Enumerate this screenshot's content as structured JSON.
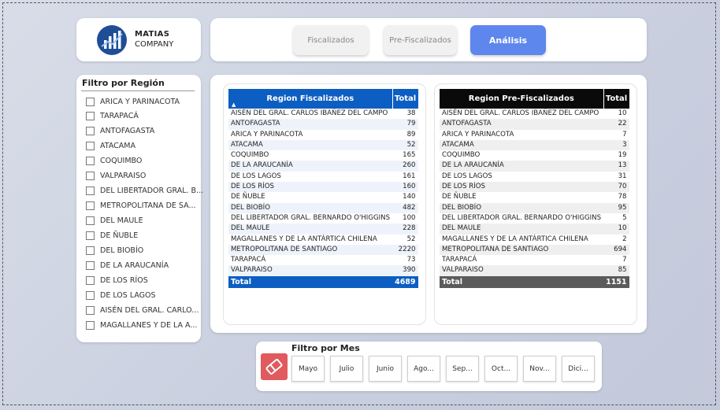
{
  "logo": {
    "line1": "MATIAS",
    "line2": "COMPANY"
  },
  "tabs": [
    {
      "label": "Fiscalizados"
    },
    {
      "label": "Pre-Fiscalizados"
    },
    {
      "label": "Análisis",
      "active": true
    }
  ],
  "region_filter": {
    "title": "Filtro por Región",
    "items": [
      "ARICA Y PARINACOTA",
      "TARAPACÁ",
      "ANTOFAGASTA",
      "ATACAMA",
      "COQUIMBO",
      "VALPARAISO",
      "DEL LIBERTADOR GRAL. B...",
      "METROPOLITANA DE SA...",
      "DEL MAULE",
      "DE ÑUBLE",
      "DEL BIOBÍO",
      "DE LA ARAUCANÍA",
      "DE LOS RÍOS",
      "DE LOS LAGOS",
      "AISÉN DEL GRAL. CARLO...",
      "MAGALLANES Y DE LA A..."
    ]
  },
  "table_fiscalizados": {
    "header_region": "Region Fiscalizados",
    "header_total": "Total",
    "rows": [
      [
        "AISÉN DEL GRAL. CARLOS IBAÑEZ DEL CAMPO",
        "38"
      ],
      [
        "ANTOFAGASTA",
        "79"
      ],
      [
        "ARICA Y PARINACOTA",
        "89"
      ],
      [
        "ATACAMA",
        "52"
      ],
      [
        "COQUIMBO",
        "165"
      ],
      [
        "DE LA ARAUCANÍA",
        "260"
      ],
      [
        "DE LOS LAGOS",
        "161"
      ],
      [
        "DE LOS RÍOS",
        "160"
      ],
      [
        "DE ÑUBLE",
        "140"
      ],
      [
        "DEL BIOBÍO",
        "482"
      ],
      [
        "DEL LIBERTADOR GRAL. BERNARDO O'HIGGINS",
        "100"
      ],
      [
        "DEL MAULE",
        "228"
      ],
      [
        "MAGALLANES Y DE LA ANTÁRTICA CHILENA",
        "52"
      ],
      [
        "METROPOLITANA DE SANTIAGO",
        "2220"
      ],
      [
        "TARAPACÁ",
        "73"
      ],
      [
        "VALPARAISO",
        "390"
      ]
    ],
    "total_label": "Total",
    "total_value": "4689"
  },
  "table_prefiscalizados": {
    "header_region": "Region Pre-Fiscalizados",
    "header_total": "Total",
    "rows": [
      [
        "AISÉN DEL GRAL. CARLOS IBAÑEZ DEL CAMPO",
        "10"
      ],
      [
        "ANTOFAGASTA",
        "22"
      ],
      [
        "ARICA Y PARINACOTA",
        "7"
      ],
      [
        "ATACAMA",
        "3"
      ],
      [
        "COQUIMBO",
        "19"
      ],
      [
        "DE LA ARAUCANÍA",
        "13"
      ],
      [
        "DE LOS LAGOS",
        "31"
      ],
      [
        "DE LOS RÍOS",
        "70"
      ],
      [
        "DE ÑUBLE",
        "78"
      ],
      [
        "DEL BIOBÍO",
        "95"
      ],
      [
        "DEL LIBERTADOR GRAL. BERNARDO O'HIGGINS",
        "5"
      ],
      [
        "DEL MAULE",
        "10"
      ],
      [
        "MAGALLANES Y DE LA ANTÁRTICA CHILENA",
        "2"
      ],
      [
        "METROPOLITANA DE SANTIAGO",
        "694"
      ],
      [
        "TARAPACÁ",
        "7"
      ],
      [
        "VALPARAISO",
        "85"
      ]
    ],
    "total_label": "Total",
    "total_value": "1151"
  },
  "month_filter": {
    "title": "Filtro por Mes",
    "months": [
      "Mayo",
      "Julio",
      "Junio",
      "Ago...",
      "Sep...",
      "Oct...",
      "Nov...",
      "Dici..."
    ]
  },
  "colors": {
    "accent": "#5d87ec",
    "table_blue": "#0d5ec2",
    "table_dark": "#0a0a0a",
    "erase_red": "#e05a5e",
    "logo_blue": "#1f4e96"
  },
  "icons": {
    "logo": "growth-chart-logo-icon",
    "sort": "sort-ascending-icon",
    "erase": "eraser-icon"
  }
}
